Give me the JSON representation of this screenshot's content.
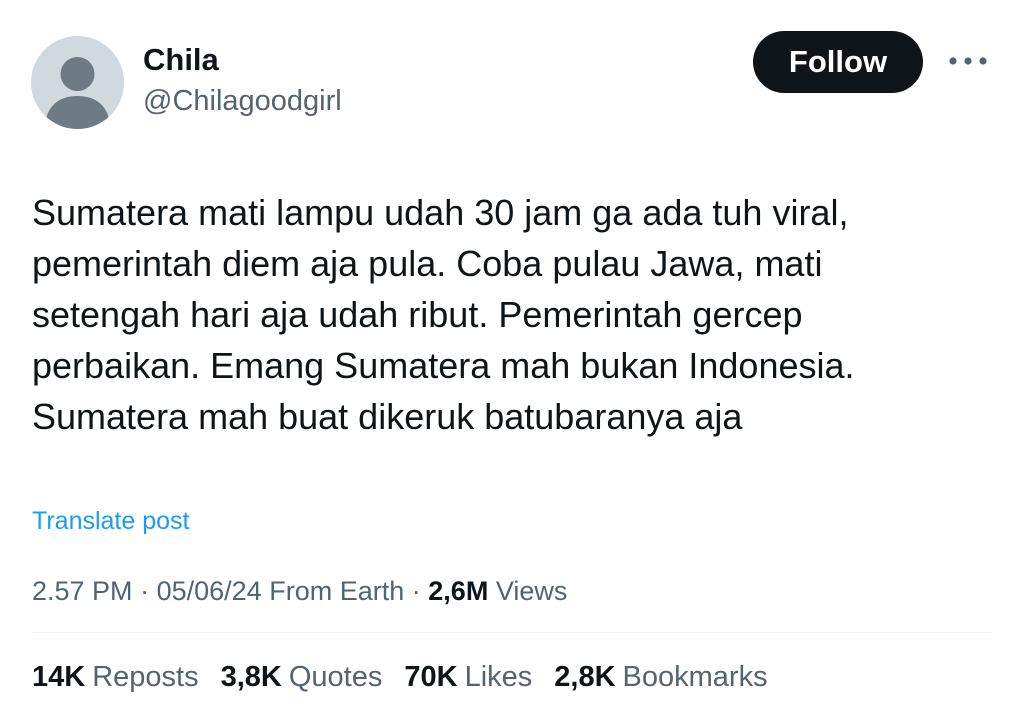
{
  "author": {
    "display_name": "Chila",
    "handle": "@Chilagoodgirl",
    "avatar_icon": "default-avatar-icon"
  },
  "actions": {
    "follow_label": "Follow",
    "more_icon": "more-horizontal-icon"
  },
  "post": {
    "lines": [
      "Sumatera mati lampu udah 30 jam ga ada tuh viral,",
      "pemerintah diem aja pula. Coba pulau Jawa, mati",
      "setengah hari aja udah ribut. Pemerintah gercep",
      "perbaikan. Emang Sumatera mah bukan Indonesia.",
      "Sumatera mah buat dikeruk batubaranya aja"
    ],
    "translate_label": "Translate post"
  },
  "meta": {
    "time": "2.57 PM",
    "separator": "·",
    "date": "05/06/24",
    "location": "From Earth",
    "views_count": "2,6M",
    "views_label": "Views"
  },
  "stats": {
    "reposts": {
      "count": "14K",
      "label": "Reposts"
    },
    "quotes": {
      "count": "3,8K",
      "label": "Quotes"
    },
    "likes": {
      "count": "70K",
      "label": "Likes"
    },
    "bookmarks": {
      "count": "2,8K",
      "label": "Bookmarks"
    }
  },
  "colors": {
    "text_primary": "#0f1419",
    "text_secondary": "#536471",
    "link": "#1d9bf0",
    "follow_bg": "#0f1419",
    "avatar_bg": "#cfd9de",
    "avatar_fg": "#6e7a84"
  }
}
